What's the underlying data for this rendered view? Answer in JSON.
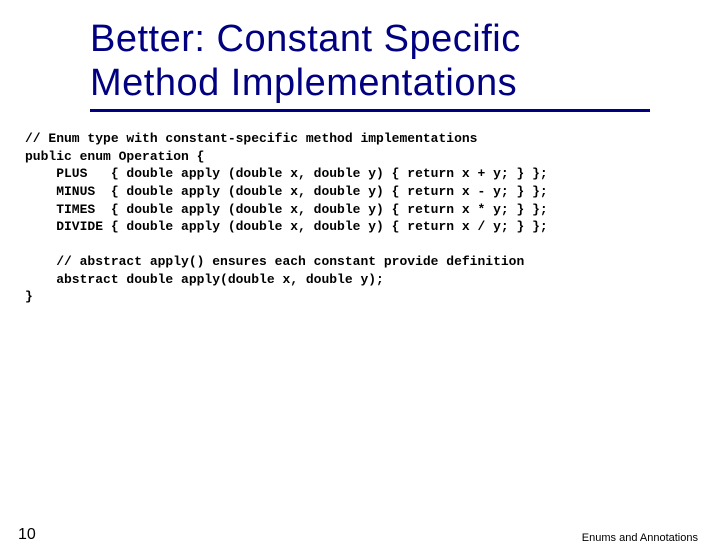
{
  "title_line1": "Better:  Constant Specific",
  "title_line2": "Method Implementations",
  "code": "// Enum type with constant-specific method implementations\npublic enum Operation {\n    PLUS   { double apply (double x, double y) { return x + y; } };\n    MINUS  { double apply (double x, double y) { return x - y; } };\n    TIMES  { double apply (double x, double y) { return x * y; } };\n    DIVIDE { double apply (double x, double y) { return x / y; } };\n\n    // abstract apply() ensures each constant provide definition\n    abstract double apply(double x, double y);\n}",
  "page_number": "10",
  "footer": "Enums and Annotations"
}
